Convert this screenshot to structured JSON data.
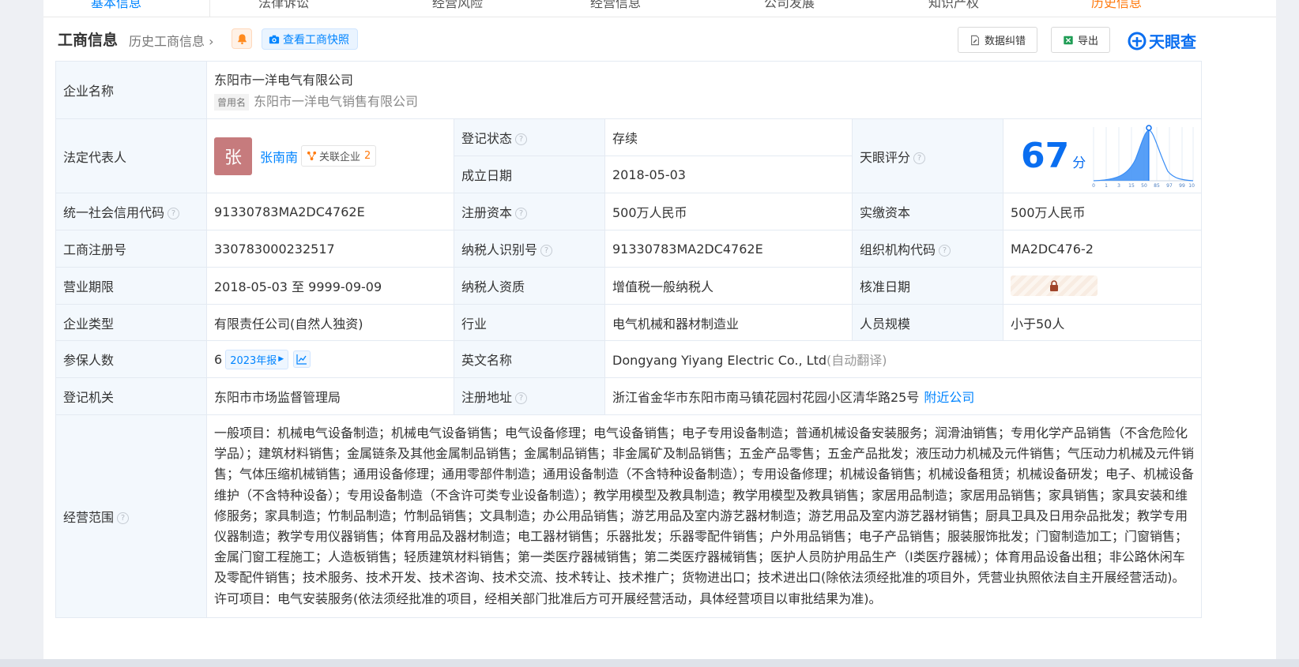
{
  "tabs": {
    "items": [
      "基本信息",
      "法律诉讼",
      "经营风险",
      "经营信息",
      "公司发展",
      "知识产权",
      "历史信息"
    ]
  },
  "header": {
    "title": "工商信息",
    "history_link": "历史工商信息",
    "snapshot_button": "查看工商快照",
    "correction_button": "数据纠错",
    "export_button": "导出",
    "logo_text": "天眼查"
  },
  "company": {
    "name_label": "企业名称",
    "name": "东阳市一洋电气有限公司",
    "former_name_tag": "曾用名",
    "former_name": "东阳市一洋电气销售有限公司",
    "legal_rep_label": "法定代表人",
    "legal_rep_avatar": "张",
    "legal_rep_name": "张南南",
    "related_label": "关联企业",
    "related_count": "2",
    "reg_status_label": "登记状态",
    "reg_status": "存续",
    "founded_label": "成立日期",
    "founded": "2018-05-03",
    "score_label": "天眼评分",
    "score": "67",
    "score_unit": "分",
    "credit_code_label": "统一社会信用代码",
    "credit_code": "91330783MA2DC4762E",
    "reg_capital_label": "注册资本",
    "reg_capital": "500万人民币",
    "paid_capital_label": "实缴资本",
    "paid_capital": "500万人民币",
    "biz_reg_no_label": "工商注册号",
    "biz_reg_no": "330783000232517",
    "taxpayer_id_label": "纳税人识别号",
    "taxpayer_id": "91330783MA2DC4762E",
    "org_code_label": "组织机构代码",
    "org_code": "MA2DC476-2",
    "term_label": "营业期限",
    "term": "2018-05-03 至 9999-09-09",
    "taxpayer_qual_label": "纳税人资质",
    "taxpayer_qual": "增值税一般纳税人",
    "approval_date_label": "核准日期",
    "type_label": "企业类型",
    "type": "有限责任公司(自然人独资)",
    "industry_label": "行业",
    "industry": "电气机械和器材制造业",
    "staff_label": "人员规模",
    "staff": "小于50人",
    "insured_label": "参保人数",
    "insured": "6",
    "insured_year": "2023年报",
    "english_name_label": "英文名称",
    "english_name": "Dongyang Yiyang Electric Co., Ltd",
    "auto_translate": "(自动翻译)",
    "authority_label": "登记机关",
    "authority": "东阳市市场监督管理局",
    "address_label": "注册地址",
    "address": "浙江省金华市东阳市南马镇花园村花园小区清华路25号",
    "nearby_link": "附近公司",
    "scope_label": "经营范围",
    "scope": "一般项目：机械电气设备制造；机械电气设备销售；电气设备修理；电气设备销售；电子专用设备制造；普通机械设备安装服务；润滑油销售；专用化学产品销售（不含危险化学品）；建筑材料销售；金属链条及其他金属制品销售；金属制品销售；非金属矿及制品销售；五金产品零售；五金产品批发；液压动力机械及元件销售；气压动力机械及元件销售；气体压缩机械销售；通用设备修理；通用零部件制造；通用设备制造（不含特种设备制造）；专用设备修理；机械设备销售；机械设备租赁；机械设备研发；电子、机械设备维护（不含特种设备）；专用设备制造（不含许可类专业设备制造）；教学用模型及教具制造；教学用模型及教具销售；家居用品制造；家居用品销售；家具销售；家具安装和维修服务；家具制造；竹制品制造；竹制品销售；文具制造；办公用品销售；游艺用品及室内游艺器材制造；游艺用品及室内游艺器材销售；厨具卫具及日用杂品批发；教学专用仪器制造；教学专用仪器销售；体育用品及器材制造；电工器材销售；乐器批发；乐器零配件销售；户外用品销售；电子产品销售；服装服饰批发；门窗制造加工；门窗销售；金属门窗工程施工；人造板销售；轻质建筑材料销售；第一类医疗器械销售；第二类医疗器械销售；医护人员防护用品生产（Ⅰ类医疗器械）；体育用品设备出租；非公路休闲车及零配件销售；技术服务、技术开发、技术咨询、技术交流、技术转让、技术推广；货物进出口；技术进出口(除依法须经批准的项目外，凭营业执照依法自主开展经营活动)。许可项目：电气安装服务(依法须经批准的项目，经相关部门批准后方可开展经营活动，具体经营项目以审批结果为准)。"
  },
  "score_chart": {
    "ticks": [
      "0",
      "1",
      "3",
      "15",
      "50",
      "85",
      "97",
      "99",
      "100"
    ]
  },
  "colors": {
    "accent": "#0084ff",
    "label_bg": "#f3f8fd",
    "status_green": "#1fac4e",
    "score_blue": "#0a6ef0"
  }
}
